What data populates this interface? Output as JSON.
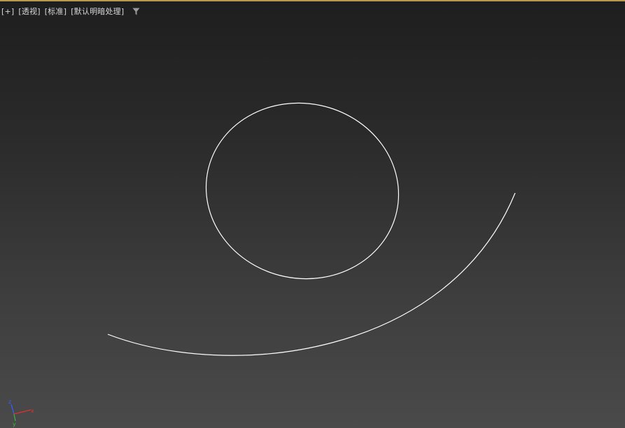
{
  "viewport": {
    "labels": {
      "plus": "[+]",
      "view": "[透视]",
      "mode": "[标准]",
      "shading": "[默认明暗处理]"
    },
    "filter_icon": "filter-icon",
    "background_top_color": "#1e1e1e",
    "background_bottom_color": "#4a4a4a",
    "accent_border_color": "#b8974e",
    "curve_color": "#ffffff"
  },
  "gizmo": {
    "axes": [
      {
        "name": "z",
        "color": "#3d5cff"
      },
      {
        "name": "x",
        "color": "#e03030"
      },
      {
        "name": "y",
        "color": "#30c030"
      }
    ]
  }
}
